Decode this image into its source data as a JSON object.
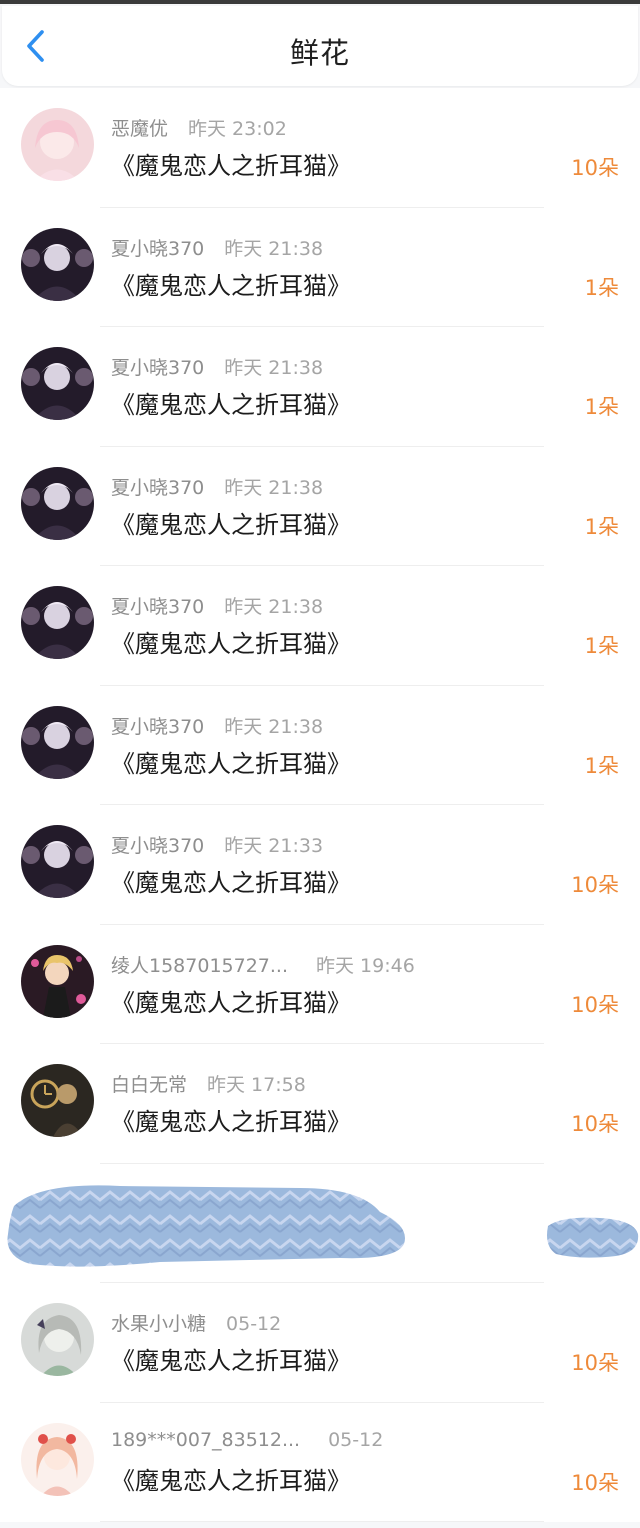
{
  "header": {
    "title": "鲜花",
    "back_icon": "chevron-left-icon"
  },
  "colors": {
    "accent": "#2e8ff0",
    "count": "#ee8a3a"
  },
  "items": [
    {
      "user": "恶魔优",
      "time": "昨天 23:02",
      "book": "《魔鬼恋人之折耳猫》",
      "count": "10朵",
      "avatar": "pink-girl"
    },
    {
      "user": "夏小晓370",
      "time": "昨天 21:38",
      "book": "《魔鬼恋人之折耳猫》",
      "count": "1朵",
      "avatar": "dark-boy"
    },
    {
      "user": "夏小晓370",
      "time": "昨天 21:38",
      "book": "《魔鬼恋人之折耳猫》",
      "count": "1朵",
      "avatar": "dark-boy"
    },
    {
      "user": "夏小晓370",
      "time": "昨天 21:38",
      "book": "《魔鬼恋人之折耳猫》",
      "count": "1朵",
      "avatar": "dark-boy"
    },
    {
      "user": "夏小晓370",
      "time": "昨天 21:38",
      "book": "《魔鬼恋人之折耳猫》",
      "count": "1朵",
      "avatar": "dark-boy"
    },
    {
      "user": "夏小晓370",
      "time": "昨天 21:38",
      "book": "《魔鬼恋人之折耳猫》",
      "count": "1朵",
      "avatar": "dark-boy"
    },
    {
      "user": "夏小晓370",
      "time": "昨天 21:33",
      "book": "《魔鬼恋人之折耳猫》",
      "count": "10朵",
      "avatar": "dark-boy"
    },
    {
      "user": "绫人1587015727...",
      "time": "昨天 19:46",
      "book": "《魔鬼恋人之折耳猫》",
      "count": "10朵",
      "avatar": "blonde-boy"
    },
    {
      "user": "白白无常",
      "time": "昨天 17:58",
      "book": "《魔鬼恋人之折耳猫》",
      "count": "10朵",
      "avatar": "gold-clock"
    },
    {
      "user": "水果小小糖",
      "time": "05-12",
      "book": "《魔鬼恋人之折耳猫》",
      "count": "10朵",
      "avatar": "grey-girl"
    },
    {
      "user": "189***007_83512...",
      "time": "05-12",
      "book": "《魔鬼恋人之折耳猫》",
      "count": "10朵",
      "avatar": "peach-girl"
    }
  ]
}
